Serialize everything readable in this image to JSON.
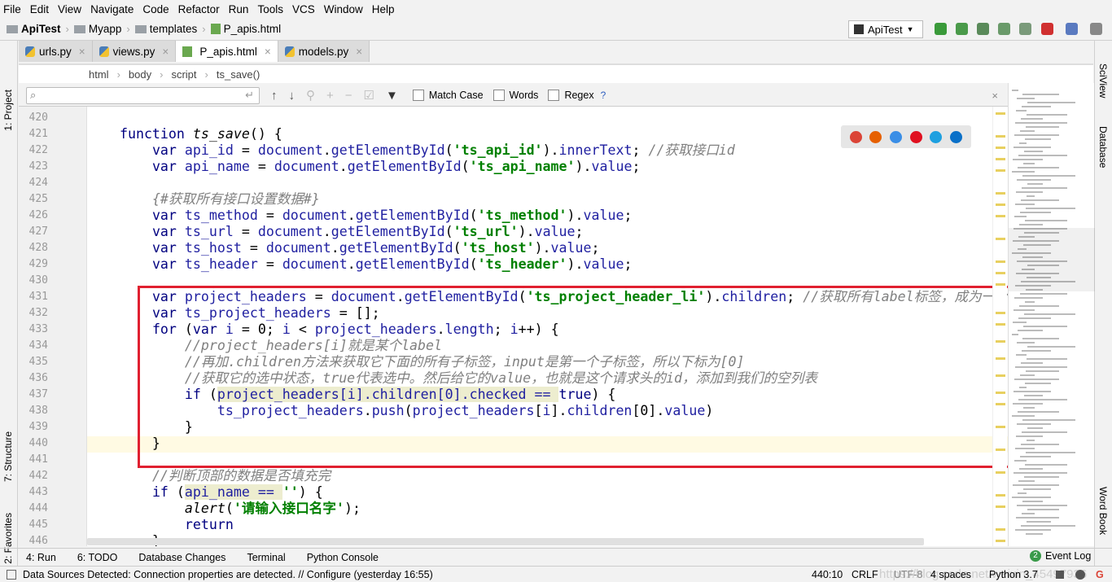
{
  "menu": [
    "File",
    "Edit",
    "View",
    "Navigate",
    "Code",
    "Refactor",
    "Run",
    "Tools",
    "VCS",
    "Window",
    "Help"
  ],
  "nav": {
    "project": "ApiTest",
    "folder1": "Myapp",
    "folder2": "templates",
    "file": "P_apis.html"
  },
  "run_config": "ApiTest",
  "left_tools": [
    "1: Project",
    "7: Structure",
    "2: Favorites"
  ],
  "right_tools": [
    "SciView",
    "Database",
    "Word Book"
  ],
  "tabs": [
    {
      "label": "urls.py",
      "type": "py"
    },
    {
      "label": "views.py",
      "type": "py"
    },
    {
      "label": "P_apis.html",
      "type": "html",
      "active": true
    },
    {
      "label": "models.py",
      "type": "py"
    }
  ],
  "breadcrumb": [
    "html",
    "body",
    "script",
    "ts_save()"
  ],
  "find": {
    "query": "",
    "placeholder": "",
    "match_case": "Match Case",
    "words": "Words",
    "regex": "Regex",
    "help": "?"
  },
  "code": [
    {
      "n": "420",
      "t": []
    },
    {
      "n": "421",
      "t": [
        [
          "p",
          "    "
        ],
        [
          "k",
          "function "
        ],
        [
          "f",
          "ts_save"
        ],
        [
          "p",
          "() {"
        ]
      ]
    },
    {
      "n": "422",
      "t": [
        [
          "p",
          "        "
        ],
        [
          "k",
          "var "
        ],
        [
          "v",
          "api_id"
        ],
        [
          "p",
          " = "
        ],
        [
          "v",
          "document"
        ],
        [
          "p",
          "."
        ],
        [
          "v",
          "getElementById"
        ],
        [
          "p",
          "("
        ],
        [
          "s",
          "'ts_api_id'"
        ],
        [
          "p",
          ")."
        ],
        [
          "v",
          "innerText"
        ],
        [
          "p",
          "; "
        ],
        [
          "c",
          "//获取接口id"
        ]
      ]
    },
    {
      "n": "423",
      "t": [
        [
          "p",
          "        "
        ],
        [
          "k",
          "var "
        ],
        [
          "v",
          "api_name"
        ],
        [
          "p",
          " = "
        ],
        [
          "v",
          "document"
        ],
        [
          "p",
          "."
        ],
        [
          "v",
          "getElementById"
        ],
        [
          "p",
          "("
        ],
        [
          "s",
          "'ts_api_name'"
        ],
        [
          "p",
          ")."
        ],
        [
          "v",
          "value"
        ],
        [
          "p",
          ";"
        ]
      ]
    },
    {
      "n": "424",
      "t": []
    },
    {
      "n": "425",
      "t": [
        [
          "p",
          "        "
        ],
        [
          "c",
          "{#获取所有接口设置数据#}"
        ]
      ]
    },
    {
      "n": "426",
      "t": [
        [
          "p",
          "        "
        ],
        [
          "k",
          "var "
        ],
        [
          "v",
          "ts_method"
        ],
        [
          "p",
          " = "
        ],
        [
          "v",
          "document"
        ],
        [
          "p",
          "."
        ],
        [
          "v",
          "getElementById"
        ],
        [
          "p",
          "("
        ],
        [
          "s",
          "'ts_method'"
        ],
        [
          "p",
          ")."
        ],
        [
          "v",
          "value"
        ],
        [
          "p",
          ";"
        ]
      ]
    },
    {
      "n": "427",
      "t": [
        [
          "p",
          "        "
        ],
        [
          "k",
          "var "
        ],
        [
          "v",
          "ts_url"
        ],
        [
          "p",
          " = "
        ],
        [
          "v",
          "document"
        ],
        [
          "p",
          "."
        ],
        [
          "v",
          "getElementById"
        ],
        [
          "p",
          "("
        ],
        [
          "s",
          "'ts_url'"
        ],
        [
          "p",
          ")."
        ],
        [
          "v",
          "value"
        ],
        [
          "p",
          ";"
        ]
      ]
    },
    {
      "n": "428",
      "t": [
        [
          "p",
          "        "
        ],
        [
          "k",
          "var "
        ],
        [
          "v",
          "ts_host"
        ],
        [
          "p",
          " = "
        ],
        [
          "v",
          "document"
        ],
        [
          "p",
          "."
        ],
        [
          "v",
          "getElementById"
        ],
        [
          "p",
          "("
        ],
        [
          "s",
          "'ts_host'"
        ],
        [
          "p",
          ")."
        ],
        [
          "v",
          "value"
        ],
        [
          "p",
          ";"
        ]
      ]
    },
    {
      "n": "429",
      "t": [
        [
          "p",
          "        "
        ],
        [
          "k",
          "var "
        ],
        [
          "v",
          "ts_header"
        ],
        [
          "p",
          " = "
        ],
        [
          "v",
          "document"
        ],
        [
          "p",
          "."
        ],
        [
          "v",
          "getElementById"
        ],
        [
          "p",
          "("
        ],
        [
          "s",
          "'ts_header'"
        ],
        [
          "p",
          ")."
        ],
        [
          "v",
          "value"
        ],
        [
          "p",
          ";"
        ]
      ]
    },
    {
      "n": "430",
      "t": []
    },
    {
      "n": "431",
      "t": [
        [
          "p",
          "        "
        ],
        [
          "k",
          "var "
        ],
        [
          "v",
          "project_headers"
        ],
        [
          "p",
          " = "
        ],
        [
          "v",
          "document"
        ],
        [
          "p",
          "."
        ],
        [
          "v",
          "getElementById"
        ],
        [
          "p",
          "("
        ],
        [
          "s",
          "'ts_project_header_li'"
        ],
        [
          "p",
          ")."
        ],
        [
          "v",
          "children"
        ],
        [
          "p",
          "; "
        ],
        [
          "c",
          "//获取所有label标签，成为一个"
        ]
      ]
    },
    {
      "n": "432",
      "t": [
        [
          "p",
          "        "
        ],
        [
          "k",
          "var "
        ],
        [
          "v",
          "ts_project_headers"
        ],
        [
          "p",
          " = [];"
        ]
      ]
    },
    {
      "n": "433",
      "t": [
        [
          "p",
          "        "
        ],
        [
          "k",
          "for "
        ],
        [
          "p",
          "("
        ],
        [
          "k",
          "var "
        ],
        [
          "v",
          "i"
        ],
        [
          "p",
          " = 0; "
        ],
        [
          "v",
          "i"
        ],
        [
          "p",
          " < "
        ],
        [
          "v",
          "project_headers"
        ],
        [
          "p",
          "."
        ],
        [
          "v",
          "length"
        ],
        [
          "p",
          "; "
        ],
        [
          "v",
          "i"
        ],
        [
          "p",
          "++) {"
        ]
      ]
    },
    {
      "n": "434",
      "t": [
        [
          "p",
          "            "
        ],
        [
          "c",
          "//project_headers[i]就是某个label"
        ]
      ]
    },
    {
      "n": "435",
      "t": [
        [
          "p",
          "            "
        ],
        [
          "c",
          "//再加.children方法来获取它下面的所有子标签，input是第一个子标签，所以下标为[0]"
        ]
      ]
    },
    {
      "n": "436",
      "t": [
        [
          "p",
          "            "
        ],
        [
          "c",
          "//获取它的选中状态，true代表选中。然后给它的value，也就是这个请求头的id，添加到我们的空列表"
        ]
      ]
    },
    {
      "n": "437",
      "t": [
        [
          "p",
          "            "
        ],
        [
          "k",
          "if "
        ],
        [
          "p",
          "("
        ],
        [
          "h",
          "project_headers[i].children[0].checked == "
        ],
        [
          "k",
          "true"
        ],
        [
          "p",
          ") {"
        ]
      ]
    },
    {
      "n": "438",
      "t": [
        [
          "p",
          "                "
        ],
        [
          "v",
          "ts_project_headers"
        ],
        [
          "p",
          "."
        ],
        [
          "v",
          "push"
        ],
        [
          "p",
          "("
        ],
        [
          "v",
          "project_headers"
        ],
        [
          "p",
          "["
        ],
        [
          "v",
          "i"
        ],
        [
          "p",
          "]."
        ],
        [
          "v",
          "children"
        ],
        [
          "p",
          "[0]."
        ],
        [
          "v",
          "value"
        ],
        [
          "p",
          ")"
        ]
      ]
    },
    {
      "n": "439",
      "t": [
        [
          "p",
          "            }"
        ]
      ]
    },
    {
      "n": "440",
      "t": [
        [
          "p",
          "        }"
        ]
      ]
    },
    {
      "n": "441",
      "t": []
    },
    {
      "n": "442",
      "t": [
        [
          "p",
          "        "
        ],
        [
          "c",
          "//判断顶部的数据是否填充完"
        ]
      ]
    },
    {
      "n": "443",
      "t": [
        [
          "p",
          "        "
        ],
        [
          "k",
          "if "
        ],
        [
          "p",
          "("
        ],
        [
          "h",
          "api_name == "
        ],
        [
          "s",
          "''"
        ],
        [
          "p",
          ") {"
        ]
      ]
    },
    {
      "n": "444",
      "t": [
        [
          "p",
          "            "
        ],
        [
          "f",
          "alert"
        ],
        [
          "p",
          "("
        ],
        [
          "s",
          "'请输入接口名字'"
        ],
        [
          "p",
          ");"
        ]
      ]
    },
    {
      "n": "445",
      "t": [
        [
          "p",
          "            "
        ],
        [
          "k",
          "return"
        ]
      ]
    },
    {
      "n": "446",
      "t": [
        [
          "p",
          "        }"
        ]
      ]
    }
  ],
  "toolwindows": [
    "4: Run",
    "6: TODO",
    "Database Changes",
    "Terminal",
    "Python Console"
  ],
  "event_log": {
    "count": "2",
    "label": "Event Log"
  },
  "status": {
    "message": "Data Sources Detected: Connection properties are detected. // Configure (yesterday 16:55)",
    "position": "440:10",
    "line_sep": "CRLF",
    "encoding": "UTF-8",
    "indent": "4 spaces",
    "interpreter": "Python 3.7"
  },
  "watermark": "https://blog.csdn.net/weixin_45497936",
  "colors": {
    "highlight_box": "#e02030",
    "keyword": "#000080",
    "string": "#008000",
    "comment": "#808080"
  }
}
